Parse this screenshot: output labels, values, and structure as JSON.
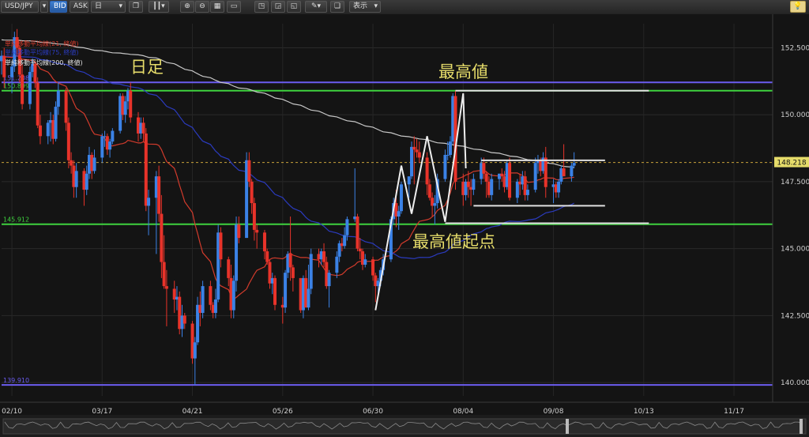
{
  "toolbar": {
    "symbol": "USD/JPY",
    "bid_label": "BID",
    "ask_label": "ASK",
    "timeframe": "日",
    "display_label": "表示"
  },
  "colors": {
    "background": "#141414",
    "candle_up": "#3b82e6",
    "candle_down": "#e8332a",
    "high_line": "#6b5cf0",
    "green_line": "#3ed23e",
    "sma21": "#d23b2c",
    "sma75": "#2b3bbf",
    "sma200": "#c8c8c8",
    "annotation": "#e6dc6a",
    "price_label_bg": "#e6dc6a"
  },
  "legend": {
    "sma21": "単純移動平均線(21, 終値)",
    "sma75": "単純移動平均線(75, 終値)",
    "sma200": "単純移動平均線(200, 終値)"
  },
  "annotations": {
    "daily": "日足",
    "high": "最高値",
    "high_start": "最高値起点"
  },
  "chart_data": {
    "type": "candlestick",
    "symbol": "USD/JPY",
    "timeframe": "日足",
    "x_ticks": [
      "02/10",
      "03/17",
      "04/21",
      "05/26",
      "06/30",
      "08/04",
      "09/08",
      "10/13",
      "11/17"
    ],
    "y_ticks": [
      "152.500",
      "150.000",
      "147.500",
      "145.000",
      "142.500",
      "140.000"
    ],
    "ylim": [
      139.5,
      153.4
    ],
    "date_range": [
      "2025-02-06",
      "2025-12-02"
    ],
    "current_price": "148.218",
    "horizontal_lines": [
      {
        "name": "range-high",
        "value": 151.208,
        "label": "151.208",
        "color": "#6b5cf0"
      },
      {
        "name": "recent-high",
        "value": 150.899,
        "label": "150.899",
        "color": "#3ed23e"
      },
      {
        "name": "high-start",
        "value": 145.912,
        "label": "145.912",
        "color": "#3ed23e"
      },
      {
        "name": "range-low",
        "value": 139.91,
        "label": "139.910",
        "color": "#6b5cf0"
      }
    ],
    "candles": [
      [
        "2025-02-06",
        152.0,
        152.4,
        151.5,
        152.2
      ],
      [
        "2025-02-07",
        152.2,
        152.5,
        151.0,
        151.4
      ],
      [
        "2025-02-10",
        151.4,
        152.0,
        150.8,
        151.8
      ],
      [
        "2025-02-11",
        151.8,
        153.1,
        151.6,
        152.9
      ],
      [
        "2025-02-12",
        152.9,
        153.2,
        152.2,
        152.5
      ],
      [
        "2025-02-13",
        152.5,
        152.6,
        151.2,
        151.5
      ],
      [
        "2025-02-14",
        151.5,
        151.9,
        150.2,
        150.4
      ],
      [
        "2025-02-17",
        150.4,
        151.8,
        150.2,
        151.6
      ],
      [
        "2025-02-18",
        151.6,
        152.1,
        151.4,
        151.9
      ],
      [
        "2025-02-19",
        151.9,
        152.0,
        151.0,
        151.2
      ],
      [
        "2025-02-20",
        151.2,
        151.4,
        149.5,
        149.6
      ],
      [
        "2025-02-21",
        149.6,
        150.0,
        148.9,
        149.2
      ],
      [
        "2025-02-24",
        149.2,
        149.8,
        148.9,
        149.7
      ],
      [
        "2025-02-25",
        149.7,
        150.1,
        149.0,
        149.8
      ],
      [
        "2025-02-26",
        149.8,
        150.0,
        148.9,
        149.1
      ],
      [
        "2025-02-27",
        149.1,
        150.5,
        149.0,
        150.3
      ],
      [
        "2025-02-28",
        150.3,
        151.2,
        150.0,
        150.9
      ],
      [
        "2025-03-03",
        150.9,
        151.0,
        149.4,
        149.7
      ],
      [
        "2025-03-04",
        149.7,
        149.9,
        148.0,
        148.3
      ],
      [
        "2025-03-05",
        148.3,
        148.6,
        147.8,
        148.1
      ],
      [
        "2025-03-06",
        148.1,
        148.3,
        146.9,
        147.3
      ],
      [
        "2025-03-07",
        147.3,
        148.2,
        146.9,
        147.9
      ],
      [
        "2025-03-10",
        147.9,
        148.0,
        146.6,
        147.2
      ],
      [
        "2025-03-11",
        147.2,
        148.1,
        147.0,
        147.8
      ],
      [
        "2025-03-12",
        147.8,
        148.8,
        147.6,
        148.5
      ],
      [
        "2025-03-13",
        148.5,
        148.6,
        147.6,
        147.9
      ],
      [
        "2025-03-14",
        147.9,
        148.7,
        147.8,
        148.4
      ],
      [
        "2025-03-17",
        148.4,
        149.3,
        148.2,
        149.2
      ],
      [
        "2025-03-18",
        149.2,
        149.4,
        148.8,
        149.2
      ],
      [
        "2025-03-19",
        149.2,
        149.3,
        148.5,
        148.7
      ],
      [
        "2025-03-20",
        148.7,
        149.1,
        148.4,
        149.0
      ],
      [
        "2025-03-21",
        149.0,
        149.5,
        148.9,
        149.4
      ],
      [
        "2025-03-24",
        149.4,
        150.8,
        149.3,
        150.7
      ],
      [
        "2025-03-25",
        150.7,
        150.8,
        149.8,
        150.0
      ],
      [
        "2025-03-26",
        150.0,
        150.7,
        149.7,
        150.5
      ],
      [
        "2025-03-27",
        150.5,
        151.0,
        150.2,
        150.9
      ],
      [
        "2025-03-28",
        150.9,
        151.2,
        149.7,
        149.9
      ],
      [
        "2025-03-31",
        149.9,
        150.1,
        149.0,
        149.3
      ],
      [
        "2025-04-01",
        149.3,
        149.9,
        149.1,
        149.7
      ],
      [
        "2025-04-02",
        149.7,
        149.9,
        149.0,
        149.3
      ],
      [
        "2025-04-03",
        149.3,
        149.5,
        146.4,
        146.6
      ],
      [
        "2025-04-04",
        146.6,
        147.2,
        145.5,
        146.9
      ],
      [
        "2025-04-07",
        146.9,
        147.9,
        144.8,
        147.7
      ],
      [
        "2025-04-08",
        147.7,
        148.1,
        146.0,
        146.3
      ],
      [
        "2025-04-09",
        146.3,
        147.0,
        143.9,
        144.5
      ],
      [
        "2025-04-10",
        144.5,
        145.5,
        143.5,
        143.6
      ],
      [
        "2025-04-11",
        143.6,
        144.2,
        142.1,
        143.5
      ],
      [
        "2025-04-14",
        143.5,
        143.8,
        142.6,
        143.1
      ],
      [
        "2025-04-15",
        143.1,
        143.6,
        142.7,
        143.2
      ],
      [
        "2025-04-16",
        143.2,
        143.4,
        141.8,
        142.0
      ],
      [
        "2025-04-17",
        142.0,
        142.9,
        141.7,
        142.5
      ],
      [
        "2025-04-18",
        142.5,
        142.6,
        142.0,
        142.2
      ],
      [
        "2025-04-21",
        142.2,
        142.3,
        140.7,
        140.9
      ],
      [
        "2025-04-22",
        140.9,
        141.7,
        139.9,
        141.5
      ],
      [
        "2025-04-23",
        141.5,
        143.2,
        141.4,
        142.9
      ],
      [
        "2025-04-24",
        142.9,
        143.4,
        142.1,
        142.6
      ],
      [
        "2025-04-25",
        142.6,
        143.8,
        142.4,
        143.6
      ],
      [
        "2025-04-28",
        143.6,
        143.8,
        142.7,
        142.9
      ],
      [
        "2025-04-29",
        142.9,
        143.0,
        142.4,
        142.6
      ],
      [
        "2025-04-30",
        142.6,
        143.5,
        142.4,
        143.1
      ],
      [
        "2025-05-01",
        143.1,
        145.9,
        143.0,
        145.6
      ],
      [
        "2025-05-02",
        145.6,
        145.8,
        144.3,
        144.6
      ],
      [
        "2025-05-05",
        144.6,
        144.7,
        143.6,
        143.9
      ],
      [
        "2025-05-06",
        143.9,
        144.4,
        142.4,
        142.7
      ],
      [
        "2025-05-07",
        142.7,
        144.0,
        142.4,
        143.8
      ],
      [
        "2025-05-08",
        143.8,
        146.2,
        143.4,
        145.9
      ],
      [
        "2025-05-09",
        145.9,
        146.2,
        145.2,
        145.4
      ],
      [
        "2025-05-12",
        145.4,
        148.6,
        145.4,
        148.3
      ],
      [
        "2025-05-13",
        148.3,
        148.6,
        147.3,
        147.5
      ],
      [
        "2025-05-14",
        147.5,
        147.6,
        146.3,
        146.7
      ],
      [
        "2025-05-15",
        146.7,
        146.9,
        145.3,
        145.7
      ],
      [
        "2025-05-16",
        145.7,
        145.9,
        145.0,
        145.6
      ],
      [
        "2025-05-19",
        145.6,
        145.7,
        144.6,
        144.9
      ],
      [
        "2025-05-20",
        144.9,
        145.0,
        144.4,
        144.5
      ],
      [
        "2025-05-21",
        144.5,
        144.6,
        143.5,
        143.7
      ],
      [
        "2025-05-22",
        143.7,
        144.1,
        143.3,
        143.9
      ],
      [
        "2025-05-23",
        143.9,
        144.0,
        142.7,
        142.9
      ],
      [
        "2025-05-26",
        142.9,
        143.2,
        142.2,
        142.8
      ],
      [
        "2025-05-27",
        142.8,
        144.2,
        142.6,
        144.1
      ],
      [
        "2025-05-28",
        144.1,
        144.9,
        143.9,
        144.8
      ],
      [
        "2025-05-29",
        144.8,
        146.2,
        143.8,
        144.3
      ],
      [
        "2025-05-30",
        144.3,
        144.4,
        143.4,
        143.9
      ],
      [
        "2025-06-02",
        143.9,
        143.9,
        142.6,
        142.7
      ],
      [
        "2025-06-03",
        142.7,
        144.0,
        142.4,
        143.9
      ],
      [
        "2025-06-04",
        143.9,
        144.2,
        142.9,
        142.8
      ],
      [
        "2025-06-05",
        142.8,
        144.4,
        142.7,
        143.5
      ],
      [
        "2025-06-06",
        143.5,
        145.0,
        143.3,
        144.8
      ],
      [
        "2025-06-09",
        144.8,
        145.0,
        144.3,
        144.6
      ],
      [
        "2025-06-10",
        144.6,
        145.0,
        144.4,
        144.9
      ],
      [
        "2025-06-11",
        144.9,
        145.2,
        144.3,
        144.5
      ],
      [
        "2025-06-12",
        144.5,
        144.7,
        143.5,
        143.6
      ],
      [
        "2025-06-13",
        143.6,
        144.2,
        142.8,
        144.1
      ],
      [
        "2025-06-16",
        144.1,
        144.9,
        143.9,
        144.7
      ],
      [
        "2025-06-17",
        144.7,
        145.3,
        144.5,
        145.2
      ],
      [
        "2025-06-18",
        145.2,
        145.4,
        144.9,
        145.1
      ],
      [
        "2025-06-19",
        145.1,
        145.8,
        145.0,
        145.5
      ],
      [
        "2025-06-20",
        145.5,
        146.2,
        145.3,
        146.1
      ],
      [
        "2025-06-23",
        146.1,
        148.0,
        146.0,
        146.2
      ],
      [
        "2025-06-24",
        146.2,
        146.3,
        144.9,
        145.0
      ],
      [
        "2025-06-25",
        145.0,
        145.4,
        144.6,
        144.9
      ],
      [
        "2025-06-26",
        144.9,
        145.0,
        144.2,
        144.4
      ],
      [
        "2025-06-27",
        144.4,
        144.8,
        144.3,
        144.6
      ],
      [
        "2025-06-30",
        144.6,
        144.7,
        143.8,
        144.0
      ],
      [
        "2025-07-01",
        144.0,
        144.1,
        143.0,
        143.6
      ],
      [
        "2025-07-02",
        143.6,
        143.9,
        143.2,
        143.8
      ],
      [
        "2025-07-03",
        143.8,
        144.3,
        143.6,
        144.2
      ],
      [
        "2025-07-04",
        144.2,
        144.8,
        144.0,
        144.6
      ],
      [
        "2025-07-07",
        144.6,
        146.2,
        144.5,
        146.1
      ],
      [
        "2025-07-08",
        146.1,
        146.9,
        145.9,
        146.7
      ],
      [
        "2025-07-09",
        146.7,
        147.2,
        145.8,
        146.2
      ],
      [
        "2025-07-10",
        146.2,
        146.6,
        145.7,
        146.4
      ],
      [
        "2025-07-11",
        146.4,
        147.5,
        146.3,
        147.4
      ],
      [
        "2025-07-14",
        147.4,
        147.6,
        146.9,
        147.7
      ],
      [
        "2025-07-15",
        147.7,
        149.0,
        147.6,
        148.8
      ],
      [
        "2025-07-16",
        148.8,
        149.2,
        147.4,
        148.7
      ],
      [
        "2025-07-17",
        148.7,
        149.1,
        148.4,
        148.6
      ],
      [
        "2025-07-18",
        148.6,
        149.0,
        148.2,
        148.4
      ],
      [
        "2025-07-21",
        148.4,
        148.6,
        147.0,
        147.4
      ],
      [
        "2025-07-22",
        147.4,
        147.6,
        146.8,
        146.9
      ],
      [
        "2025-07-23",
        146.9,
        147.1,
        146.2,
        146.6
      ],
      [
        "2025-07-24",
        146.6,
        147.0,
        145.9,
        146.7
      ],
      [
        "2025-07-25",
        146.7,
        147.8,
        146.5,
        147.6
      ],
      [
        "2025-07-28",
        147.6,
        148.7,
        147.5,
        148.5
      ],
      [
        "2025-07-29",
        148.5,
        149.0,
        148.3,
        148.5
      ],
      [
        "2025-07-30",
        148.5,
        149.2,
        148.4,
        149.0
      ],
      [
        "2025-07-31",
        149.0,
        150.8,
        148.9,
        150.7
      ],
      [
        "2025-08-01",
        150.7,
        150.9,
        147.2,
        147.5
      ],
      [
        "2025-08-04",
        147.5,
        147.8,
        146.6,
        147.0
      ],
      [
        "2025-08-05",
        147.0,
        147.6,
        146.8,
        147.5
      ],
      [
        "2025-08-06",
        147.5,
        147.9,
        146.9,
        147.3
      ],
      [
        "2025-08-07",
        147.3,
        147.6,
        146.6,
        147.2
      ],
      [
        "2025-08-08",
        147.2,
        147.8,
        147.0,
        147.6
      ],
      [
        "2025-08-11",
        147.6,
        148.4,
        147.4,
        148.2
      ],
      [
        "2025-08-12",
        148.2,
        148.4,
        147.6,
        147.8
      ],
      [
        "2025-08-13",
        147.8,
        147.9,
        146.9,
        147.5
      ],
      [
        "2025-08-14",
        147.5,
        147.7,
        146.9,
        147.0
      ],
      [
        "2025-08-15",
        147.0,
        147.8,
        146.8,
        147.6
      ],
      [
        "2025-08-18",
        147.6,
        147.8,
        147.2,
        147.8
      ],
      [
        "2025-08-19",
        147.8,
        148.0,
        147.5,
        147.7
      ],
      [
        "2025-08-20",
        147.7,
        147.9,
        147.1,
        147.3
      ],
      [
        "2025-08-21",
        147.3,
        148.3,
        147.2,
        148.2
      ],
      [
        "2025-08-22",
        148.2,
        148.4,
        146.8,
        146.9
      ],
      [
        "2025-08-25",
        146.9,
        147.6,
        146.7,
        147.5
      ],
      [
        "2025-08-26",
        147.5,
        147.8,
        147.0,
        147.4
      ],
      [
        "2025-08-27",
        147.4,
        147.9,
        147.2,
        147.7
      ],
      [
        "2025-08-28",
        147.7,
        147.9,
        146.8,
        147.0
      ],
      [
        "2025-08-29",
        147.0,
        147.4,
        146.8,
        147.2
      ],
      [
        "2025-09-01",
        147.2,
        148.4,
        147.1,
        148.2
      ],
      [
        "2025-09-02",
        148.2,
        148.5,
        147.8,
        148.3
      ],
      [
        "2025-09-03",
        148.3,
        148.4,
        147.7,
        147.9
      ],
      [
        "2025-09-04",
        147.9,
        148.6,
        147.8,
        148.4
      ],
      [
        "2025-09-05",
        148.4,
        148.8,
        146.9,
        147.3
      ],
      [
        "2025-09-08",
        147.3,
        147.6,
        146.7,
        147.4
      ],
      [
        "2025-09-09",
        147.4,
        147.5,
        146.9,
        147.1
      ],
      [
        "2025-09-10",
        147.1,
        147.6,
        146.9,
        147.5
      ],
      [
        "2025-09-11",
        147.5,
        148.1,
        147.4,
        148.0
      ],
      [
        "2025-09-12",
        148.0,
        148.9,
        147.9,
        147.7
      ],
      [
        "2025-09-15",
        147.7,
        148.2,
        147.5,
        148.1
      ],
      [
        "2025-09-16",
        148.1,
        148.6,
        148.0,
        148.2
      ]
    ]
  }
}
